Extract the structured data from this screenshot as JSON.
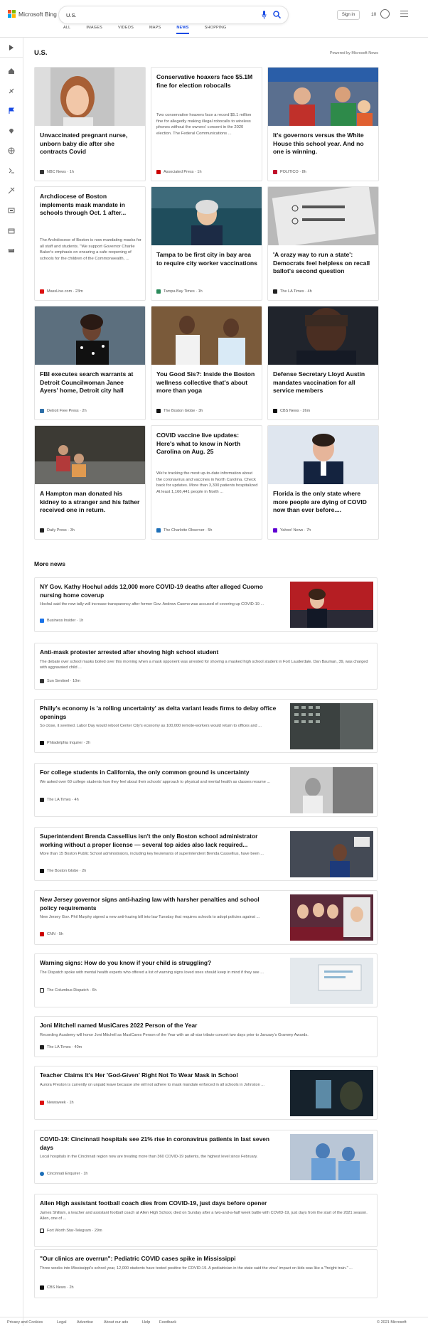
{
  "brand": {
    "name": "Microsoft Bing"
  },
  "search": {
    "value": "U.S.",
    "placeholder": ""
  },
  "header": {
    "signin": "Sign in",
    "rewards_count": "10"
  },
  "tabs": [
    "ALL",
    "IMAGES",
    "VIDEOS",
    "MAPS",
    "NEWS",
    "SHOPPING"
  ],
  "active_tab": "NEWS",
  "page": {
    "title": "U.S.",
    "powered": "Powered by Microsoft News"
  },
  "cards": [
    {
      "title": "Unvaccinated pregnant nurse, unborn baby die after she contracts Covid",
      "source": "NBC News",
      "time": "1h"
    },
    {
      "title": "Conservative hoaxers face $5.1M fine for election robocalls",
      "snippet": "Two conservative hoaxers face a record $5.1 million fine for allegedly making illegal robocalls to wireless phones without the owners' consent in the 2020 election. The Federal Communications ...",
      "source": "Associated Press",
      "time": "1h"
    },
    {
      "title": "It's governors versus the White House this school year. And no one is winning.",
      "source": "POLITICO",
      "time": "8h"
    },
    {
      "title": "Archdiocese of Boston implements mask mandate in schools through Oct. 1 after...",
      "snippet": "The Archdiocese of Boston is now mandating masks for all staff and students. \"We support Governor Charlie Baker's emphasis on ensuring a safe reopening of schools for the children of the Commonwealth, ...",
      "source": "MassLive.com",
      "time": "23m"
    },
    {
      "title": "Tampa to be first city in bay area to require city worker vaccinations",
      "source": "Tampa Bay Times",
      "time": "1h"
    },
    {
      "title": "'A crazy way to run a state': Democrats feel helpless on recall ballot's second question",
      "source": "The LA Times",
      "time": "4h"
    },
    {
      "title": "FBI executes search warrants at Detroit Councilwoman Janee Ayers' home, Detroit city hall",
      "source": "Detroit Free Press",
      "time": "2h"
    },
    {
      "title": "You Good Sis?: Inside the Boston wellness collective that's about more than yoga",
      "source": "The Boston Globe",
      "time": "3h"
    },
    {
      "title": "Defense Secretary Lloyd Austin mandates vaccination for all service members",
      "source": "CBS News",
      "time": "26m"
    },
    {
      "title": "A Hampton man donated his kidney to a stranger and his father received one in return.",
      "source": "Daily Press",
      "time": "3h"
    },
    {
      "title": "COVID vaccine live updates: Here's what to know in North Carolina on Aug. 25",
      "snippet": "We're tracking the most up-to-date information about the coronavirus and vaccines in North Carolina. Check back for updates. More than 3,300 patients hospitalized At least 1,166,441 people in North ...",
      "source": "The Charlotte Observer",
      "time": "5h"
    },
    {
      "title": "Florida is the only state where more people are dying of COVID now than ever before....",
      "source": "Yahoo! News",
      "time": "7h"
    }
  ],
  "more_news_title": "More news",
  "more_news": [
    {
      "title": "NY Gov. Kathy Hochul adds 12,000 more COVID-19 deaths after alleged Cuomo nursing home coverup",
      "snippet": "Hochul said the new tally will increase transparency after former Gov. Andrew Cuomo was accused of covering up COVID-19 ...",
      "source": "Business Insider",
      "time": "1h"
    },
    {
      "title": "Anti-mask protester arrested after shoving high school student",
      "snippet": "The debate over school masks boiled over this morning when a mask opponent was arrested for shoving a masked high school student in Fort Lauderdale. Dan Bauman, 39, was charged with aggravated child ...",
      "source": "Sun Sentinel",
      "time": "10m"
    },
    {
      "title": "Philly's economy is 'a rolling uncertainty' as delta variant leads firms to delay office openings",
      "snippet": "So close, it seemed. Labor Day would reboot Center City's economy as 100,000 remote-workers would return to offices and ...",
      "source": "Philadelphia Inquirer",
      "time": "2h"
    },
    {
      "title": "For college students in California, the only common ground is uncertainty",
      "snippet": "We asked over 60 college students how they feel about their schools' approach to physical and mental health as classes resume ...",
      "source": "The LA Times",
      "time": "4h"
    },
    {
      "title": "Superintendent Brenda Cassellius isn't the only Boston school administrator working without a proper license — several top aides also lack required...",
      "snippet": "More than 15 Boston Public School administrators, including key lieutenants of superintendent Brenda Cassellius, have been ...",
      "source": "The Boston Globe",
      "time": "2h"
    },
    {
      "title": "New Jersey governor signs anti-hazing law with harsher penalties and school policy requirements",
      "snippet": "New Jersey Gov. Phil Murphy signed a new anti-hazing bill into law Tuesday that requires schools to adopt policies against ...",
      "source": "CNN",
      "time": "5h"
    },
    {
      "title": "Warning signs: How do you know if your child is struggling?",
      "snippet": "The Dispatch spoke with mental health experts who offered a list of warning signs loved ones should keep in mind if they see ...",
      "source": "The Columbus Dispatch",
      "time": "6h"
    },
    {
      "title": "Joni Mitchell named MusiCares 2022 Person of the Year",
      "snippet": "Recording Academy will honor Joni Mitchell as MusiCares Person of the Year with an all-star tribute concert two days prior to January's Grammy Awards.",
      "source": "The LA Times",
      "time": "40m"
    },
    {
      "title": "Teacher Claims It's Her 'God-Given' Right Not To Wear Mask in School",
      "snippet": "Aurora Preston is currently on unpaid leave because she will not adhere to mask mandate enforced in all schools in Johnston ...",
      "source": "Newsweek",
      "time": "1h"
    },
    {
      "title": "COVID-19: Cincinnati hospitals see 21% rise in coronavirus patients in last seven days",
      "snippet": "Local hospitals in the Cincinnati region now are treating more than 360 COVID-19 patients, the highest level since February.",
      "source": "Cincinnati Enquirer",
      "time": "1h"
    },
    {
      "title": "Allen High assistant football coach dies from COVID-19, just days before opener",
      "snippet": "James Shillam, a teacher and assistant football coach at Allen High School, died on Sunday after a two-and-a-half week battle with COVID-19, just days from the start of the 2021 season. Allen, one of ...",
      "source": "Fort Worth Star-Telegram",
      "time": "29m"
    },
    {
      "title": "\"Our clinics are overrun\": Pediatric COVID cases spike in Mississippi",
      "snippet": "Three weeks into Mississippi's school year, 12,000 students have tested positive for COVID-19. A pediatrician in the state said the virus' impact on kids was like a \"freight train.\" ...",
      "source": "CBS News",
      "time": "2h"
    }
  ],
  "footer": {
    "links": [
      "Privacy and Cookies",
      "Legal",
      "Advertise",
      "About our ads",
      "Help",
      "Feedback"
    ],
    "copyright": "© 2021 Microsoft"
  },
  "colors": {
    "accent": "#174ae4",
    "ms_red": "#f25022",
    "ms_green": "#7fba00",
    "ms_blue": "#00a4ef",
    "ms_yellow": "#ffb900"
  }
}
